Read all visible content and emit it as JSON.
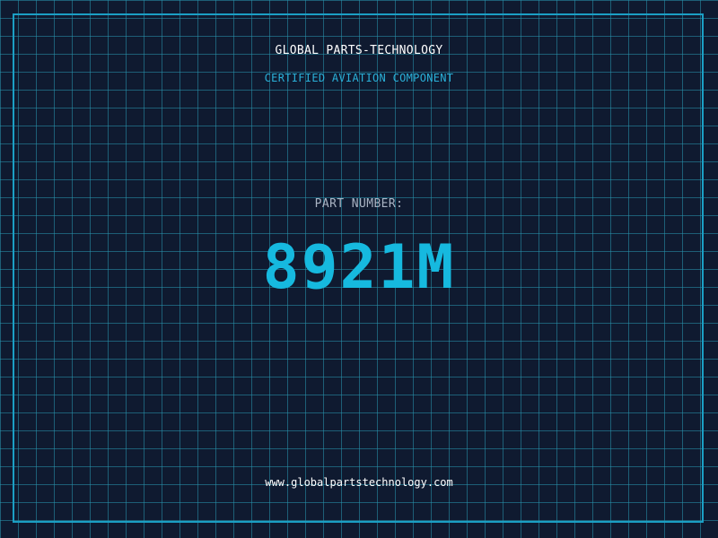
{
  "header": {
    "company": "GLOBAL PARTS-TECHNOLOGY",
    "subtitle": "CERTIFIED AVIATION COMPONENT"
  },
  "part": {
    "label": "PART NUMBER:",
    "number": "8921M"
  },
  "footer": {
    "url": "www.globalpartstechnology.com"
  },
  "colors": {
    "background": "#0f1a30",
    "grid": "#2896af",
    "accent": "#16b9df",
    "frame": "#1b9fc4"
  }
}
